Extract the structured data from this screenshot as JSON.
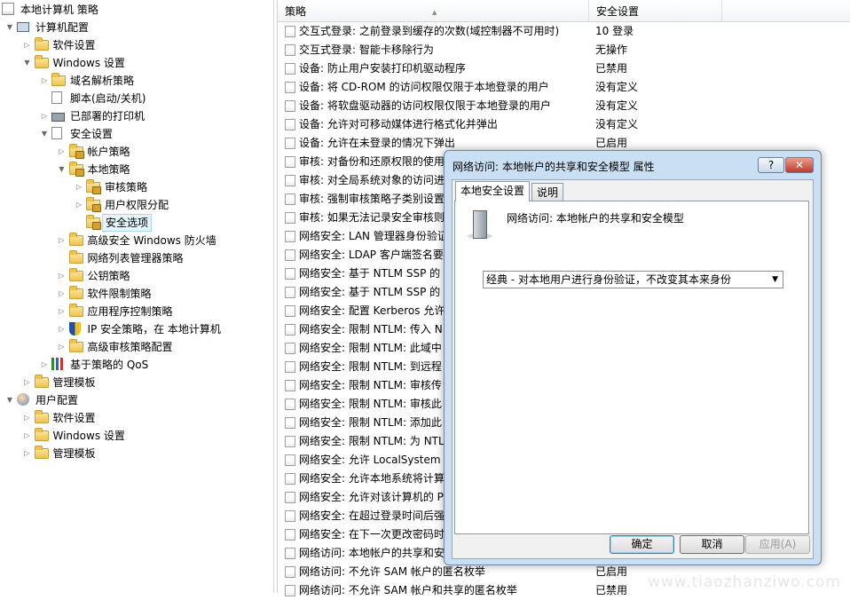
{
  "tree": [
    {
      "label": "本地计算机 策略",
      "icon": "policy-icon",
      "arrow": "",
      "level": 0
    },
    {
      "label": "计算机配置",
      "icon": "computer-icon",
      "arrow": "▼",
      "level": 1
    },
    {
      "label": "软件设置",
      "icon": "folder-icon",
      "arrow": "▷",
      "level": 2
    },
    {
      "label": "Windows 设置",
      "icon": "folder-icon",
      "arrow": "▼",
      "level": 2
    },
    {
      "label": "域名解析策略",
      "icon": "folder-icon",
      "arrow": "▷",
      "level": 3
    },
    {
      "label": "脚本(启动/关机)",
      "icon": "document-icon",
      "arrow": "",
      "level": 3
    },
    {
      "label": "已部署的打印机",
      "icon": "printer-icon",
      "arrow": "▷",
      "level": 3
    },
    {
      "label": "安全设置",
      "icon": "document-icon",
      "arrow": "▼",
      "level": 3
    },
    {
      "label": "帐户策略",
      "icon": "locked-folder-icon",
      "arrow": "▷",
      "level": 4
    },
    {
      "label": "本地策略",
      "icon": "locked-folder-icon",
      "arrow": "▼",
      "level": 4
    },
    {
      "label": "审核策略",
      "icon": "locked-folder-icon",
      "arrow": "▷",
      "level": 5
    },
    {
      "label": "用户权限分配",
      "icon": "locked-folder-icon",
      "arrow": "▷",
      "level": 5
    },
    {
      "label": "安全选项",
      "icon": "locked-folder-icon",
      "arrow": "",
      "level": 5,
      "selected": true
    },
    {
      "label": "高级安全 Windows 防火墙",
      "icon": "folder-icon",
      "arrow": "▷",
      "level": 4
    },
    {
      "label": "网络列表管理器策略",
      "icon": "folder-icon",
      "arrow": "",
      "level": 4
    },
    {
      "label": "公钥策略",
      "icon": "folder-icon",
      "arrow": "▷",
      "level": 4
    },
    {
      "label": "软件限制策略",
      "icon": "folder-icon",
      "arrow": "▷",
      "level": 4
    },
    {
      "label": "应用程序控制策略",
      "icon": "folder-icon",
      "arrow": "▷",
      "level": 4
    },
    {
      "label": "IP 安全策略，在 本地计算机",
      "icon": "shield-icon",
      "arrow": "▷",
      "level": 4
    },
    {
      "label": "高级审核策略配置",
      "icon": "folder-icon",
      "arrow": "▷",
      "level": 4
    },
    {
      "label": "基于策略的 QoS",
      "icon": "chart-icon",
      "arrow": "▷",
      "level": 3
    },
    {
      "label": "管理模板",
      "icon": "folder-icon",
      "arrow": "▷",
      "level": 2
    },
    {
      "label": "用户配置",
      "icon": "users-icon",
      "arrow": "▼",
      "level": 1
    },
    {
      "label": "软件设置",
      "icon": "folder-icon",
      "arrow": "▷",
      "level": 2
    },
    {
      "label": "Windows 设置",
      "icon": "folder-icon",
      "arrow": "▷",
      "level": 2
    },
    {
      "label": "管理模板",
      "icon": "folder-icon",
      "arrow": "▷",
      "level": 2
    }
  ],
  "columns": {
    "policy": "策略",
    "setting": "安全设置"
  },
  "rows": [
    {
      "name": "交互式登录: 之前登录到缓存的次数(域控制器不可用时)",
      "value": "10 登录"
    },
    {
      "name": "交互式登录: 智能卡移除行为",
      "value": "无操作"
    },
    {
      "name": "设备: 防止用户安装打印机驱动程序",
      "value": "已禁用"
    },
    {
      "name": "设备: 将 CD-ROM 的访问权限仅限于本地登录的用户",
      "value": "没有定义"
    },
    {
      "name": "设备: 将软盘驱动器的访问权限仅限于本地登录的用户",
      "value": "没有定义"
    },
    {
      "name": "设备: 允许对可移动媒体进行格式化并弹出",
      "value": "没有定义"
    },
    {
      "name": "设备: 允许在未登录的情况下弹出",
      "value": "已启用"
    },
    {
      "name": "审核: 对备份和还原权限的使用",
      "value": ""
    },
    {
      "name": "审核: 对全局系统对象的访问进",
      "value": ""
    },
    {
      "name": "审核: 强制审核策略子类别设置",
      "value": ""
    },
    {
      "name": "审核: 如果无法记录安全审核则",
      "value": ""
    },
    {
      "name": "网络安全: LAN 管理器身份验证",
      "value": ""
    },
    {
      "name": "网络安全: LDAP 客户端签名要",
      "value": ""
    },
    {
      "name": "网络安全: 基于 NTLM SSP 的",
      "value": ""
    },
    {
      "name": "网络安全: 基于 NTLM SSP 的",
      "value": ""
    },
    {
      "name": "网络安全: 配置 Kerberos 允许",
      "value": ""
    },
    {
      "name": "网络安全: 限制 NTLM: 传入 N",
      "value": ""
    },
    {
      "name": "网络安全: 限制 NTLM: 此域中",
      "value": ""
    },
    {
      "name": "网络安全: 限制 NTLM: 到远程",
      "value": ""
    },
    {
      "name": "网络安全: 限制 NTLM: 审核传",
      "value": ""
    },
    {
      "name": "网络安全: 限制 NTLM: 审核此",
      "value": ""
    },
    {
      "name": "网络安全: 限制 NTLM: 添加此",
      "value": ""
    },
    {
      "name": "网络安全: 限制 NTLM: 为 NTL",
      "value": ""
    },
    {
      "name": "网络安全: 允许 LocalSystem N",
      "value": ""
    },
    {
      "name": "网络安全: 允许本地系统将计算",
      "value": ""
    },
    {
      "name": "网络安全: 允许对该计算机的 P",
      "value": ""
    },
    {
      "name": "网络安全: 在超过登录时间后强",
      "value": ""
    },
    {
      "name": "网络安全: 在下一次更改密码时",
      "value": ""
    },
    {
      "name": "网络访问: 本地帐户的共享和安",
      "value": ""
    },
    {
      "name": "网络访问: 不允许 SAM 帐户的匿名枚举",
      "value": "已启用"
    },
    {
      "name": "网络访问: 不允许 SAM 帐户和共享的匿名枚举",
      "value": "已禁用"
    }
  ],
  "dialog": {
    "title": "网络访问: 本地帐户的共享和安全模型 属性",
    "help_label": "?",
    "close_label": "✕",
    "tabs": [
      "本地安全设置",
      "说明"
    ],
    "policy_name": "网络访问: 本地帐户的共享和安全模型",
    "selected_option": "经典 - 对本地用户进行身份验证，不改变其本来身份",
    "ok_label": "确定",
    "cancel_label": "取消",
    "apply_label": "应用(A)"
  },
  "watermark": "www.tiaozhanziwo.com"
}
